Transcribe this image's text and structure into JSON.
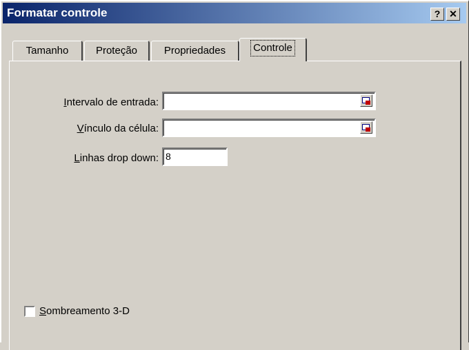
{
  "window": {
    "title": "Formatar controle",
    "help_label": "?",
    "close_label": "✕"
  },
  "tabs": [
    {
      "label": "Tamanho",
      "active": false
    },
    {
      "label": "Proteção",
      "active": false
    },
    {
      "label": "Propriedades",
      "active": false
    },
    {
      "label": "Controle",
      "active": true
    }
  ],
  "form": {
    "input_range": {
      "label_accel": "I",
      "label_rest": "ntervalo de entrada:",
      "value": ""
    },
    "cell_link": {
      "label_accel": "V",
      "label_rest": "ínculo da célula:",
      "value": ""
    },
    "dropdown_lines": {
      "label_accel": "L",
      "label_rest": "inhas drop down:",
      "value": "8"
    },
    "shading_3d": {
      "label_accel": "S",
      "label_rest": "ombreamento 3-D",
      "checked": false
    }
  },
  "icons": {
    "ref": "collapse-dialog-icon",
    "help": "help-icon",
    "close": "close-icon"
  }
}
